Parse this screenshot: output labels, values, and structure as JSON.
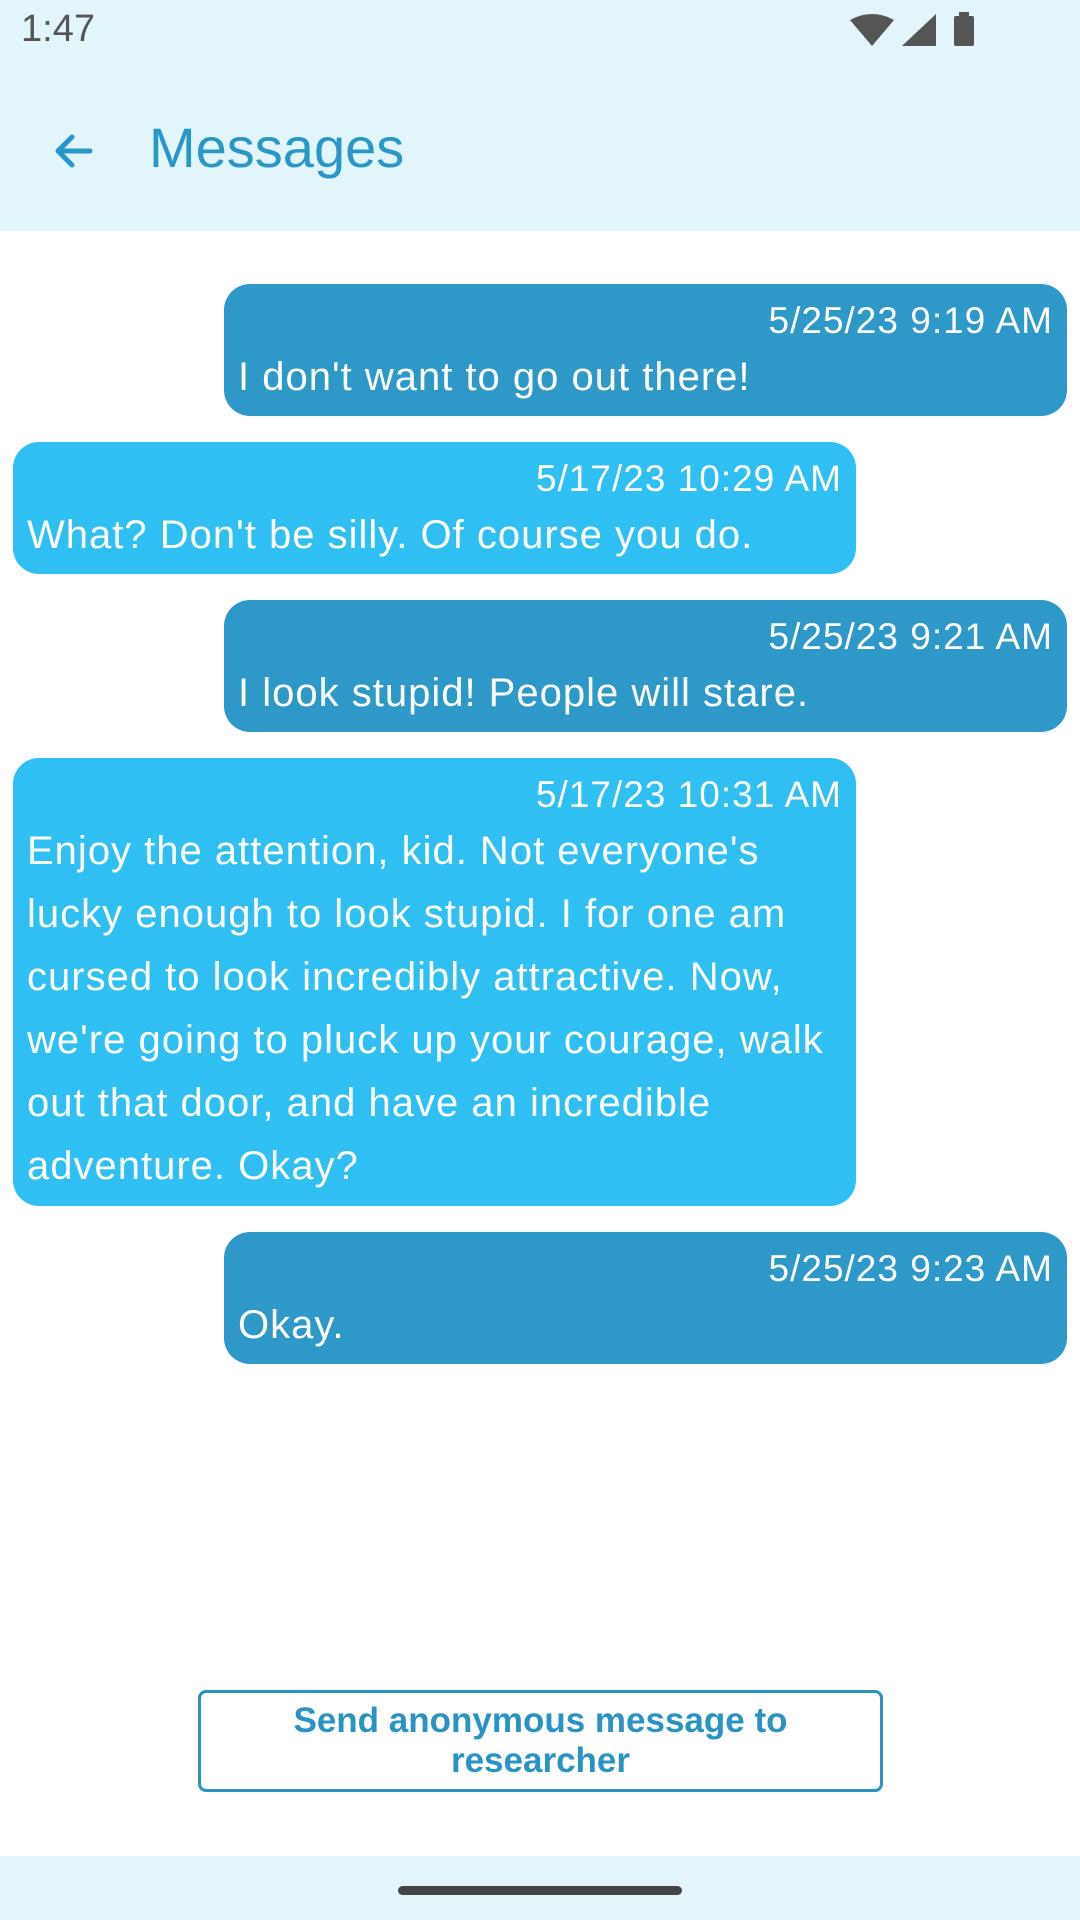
{
  "status_bar": {
    "time": "1:47",
    "icons": [
      "wifi-icon",
      "signal-icon",
      "battery-icon"
    ]
  },
  "app_bar": {
    "back_icon": "arrow-left-icon",
    "title": "Messages"
  },
  "messages": [
    {
      "sender": "me",
      "timestamp": "5/25/23 9:19 AM",
      "text": "I don't want to go out there!"
    },
    {
      "sender": "them",
      "timestamp": "5/17/23 10:29 AM",
      "text": "What? Don't be silly. Of course you do."
    },
    {
      "sender": "me",
      "timestamp": "5/25/23 9:21 AM",
      "text": "I look stupid! People will stare."
    },
    {
      "sender": "them",
      "timestamp": "5/17/23 10:31 AM",
      "text": "Enjoy the attention, kid. Not everyone's lucky enough to look stupid. I for one am cursed to look incredibly attractive. Now, we're going to pluck up your courage, walk out that door, and have an incredible adventure. Okay?"
    },
    {
      "sender": "me",
      "timestamp": "5/25/23 9:23 AM",
      "text": "Okay."
    }
  ],
  "send_button": {
    "label": "Send anonymous message to researcher"
  },
  "colors": {
    "bar_background": "#e1f5fb",
    "accent": "#2996c8",
    "my_bubble": "#2e98c8",
    "their_bubble": "#2fbff2"
  }
}
